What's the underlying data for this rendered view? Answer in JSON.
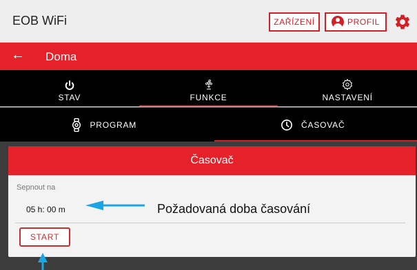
{
  "app": {
    "title": "EOB WiFi"
  },
  "header": {
    "devices_label": "ZAŘÍZENÍ",
    "profile_label": "PROFIL"
  },
  "location": {
    "title": "Doma",
    "back_icon": "←"
  },
  "main_tabs": [
    {
      "label": "STAV",
      "icon": "power-icon"
    },
    {
      "label": "FUNKCE",
      "icon": "fan-icon",
      "active": true
    },
    {
      "label": "NASTAVENÍ",
      "icon": "gear-icon"
    }
  ],
  "sub_tabs": [
    {
      "label": "PROGRAM",
      "icon": "watch-icon"
    },
    {
      "label": "ČASOVAČ",
      "icon": "clock-icon",
      "active": true
    }
  ],
  "timer": {
    "title": "Časovač",
    "field_label": "Sepnout na",
    "value": "05 h: 00 m",
    "start_label": "START"
  },
  "annotation": {
    "text": "Požadovaná doba časování"
  },
  "colors": {
    "accent_red": "#e52129",
    "annotation_blue": "#1aa6e4"
  }
}
